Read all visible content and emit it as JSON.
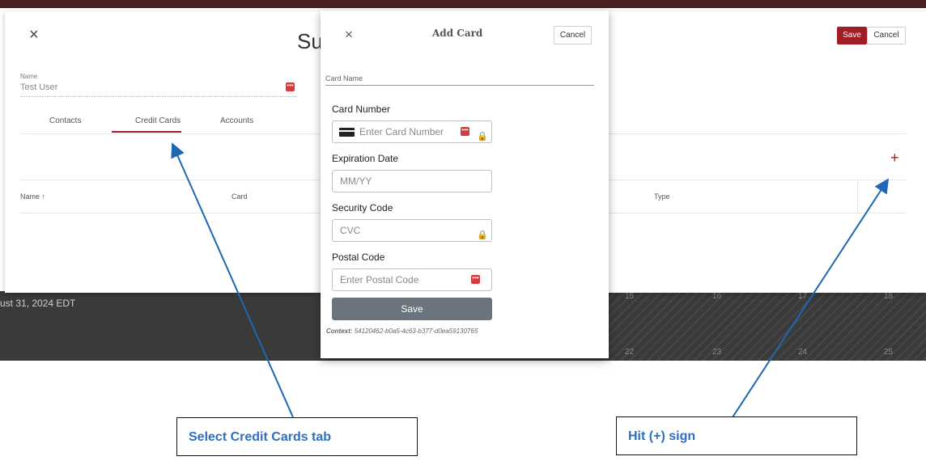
{
  "background": {
    "date_text": "ust 31, 2024 EDT",
    "calendar_numbers": [
      "15",
      "16",
      "17",
      "18",
      "22",
      "23",
      "24",
      "25"
    ]
  },
  "subscriber_modal": {
    "close_glyph": "×",
    "title_partial": "Su",
    "save_label": "Save",
    "cancel_label": "Cancel",
    "name_label": "Name",
    "name_value": "Test User",
    "tabs": [
      {
        "label": "Contacts",
        "active": false
      },
      {
        "label": "Credit Cards",
        "active": true
      },
      {
        "label": "Accounts",
        "active": false
      }
    ],
    "add_glyph": "+",
    "table_headers": {
      "name": "Name ↑",
      "card": "Card",
      "type": "Type"
    }
  },
  "add_card_modal": {
    "close_glyph": "×",
    "title": "Add Card",
    "cancel_label": "Cancel",
    "card_name_label": "Card Name",
    "card_number_label": "Card Number",
    "card_number_placeholder": "Enter Card Number",
    "expiration_label": "Expiration Date",
    "expiration_placeholder": "MM/YY",
    "security_label": "Security Code",
    "security_placeholder": "CVC",
    "postal_label": "Postal Code",
    "postal_placeholder": "Enter Postal Code",
    "save_label": "Save",
    "context_label": "Context:",
    "context_value": "54120462-b0a5-4c63-b377-d0ea59130765"
  },
  "annotations": {
    "left": "Select Credit Cards tab",
    "right": "Hit (+) sign"
  },
  "colors": {
    "brand_red": "#a11d26",
    "annotation_blue": "#2f6fbf",
    "save_gray": "#6b747c"
  },
  "icons": [
    "close-icon",
    "dots-icon",
    "plus-icon",
    "credit-card-icon",
    "lock-icon",
    "sort-arrow-icon"
  ]
}
